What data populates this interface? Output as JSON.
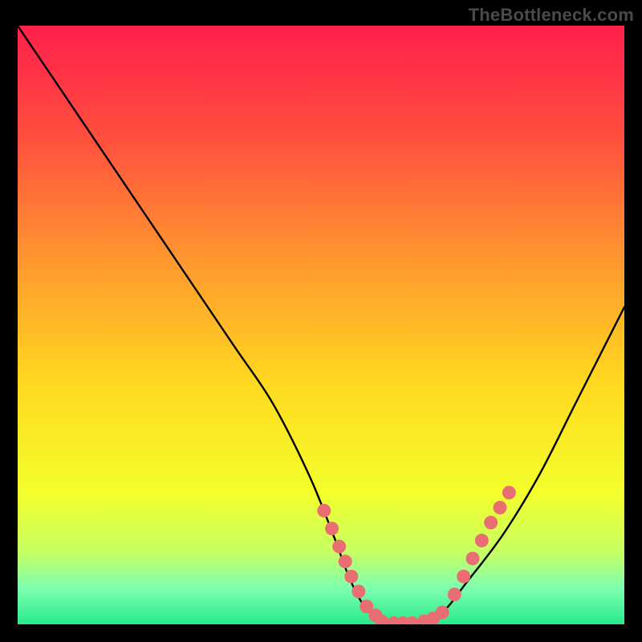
{
  "watermark": "TheBottleneck.com",
  "chart_data": {
    "type": "line",
    "title": "",
    "xlabel": "",
    "ylabel": "",
    "xlim": [
      0,
      100
    ],
    "ylim": [
      0,
      100
    ],
    "grid": false,
    "legend": false,
    "series": [
      {
        "name": "bottleneck-curve",
        "x": [
          0,
          6,
          12,
          18,
          24,
          30,
          36,
          42,
          48,
          52,
          55,
          58,
          62,
          66,
          70,
          74,
          80,
          86,
          92,
          100
        ],
        "y": [
          100,
          91,
          82,
          73,
          64,
          55,
          46,
          37,
          25,
          15,
          7,
          2,
          0,
          0,
          2,
          7,
          15,
          25,
          37,
          53
        ]
      }
    ],
    "markers": [
      {
        "name": "left-dots",
        "x": [
          50.5,
          51.8,
          53.0,
          54.0,
          55.0,
          56.2,
          57.5,
          59.0
        ],
        "y": [
          19.0,
          16.0,
          13.0,
          10.5,
          8.0,
          5.5,
          3.0,
          1.5
        ]
      },
      {
        "name": "bottom-dots",
        "x": [
          60.0,
          62.0,
          63.5,
          65.0,
          67.0,
          68.5,
          70.0
        ],
        "y": [
          0.5,
          0.2,
          0.2,
          0.2,
          0.5,
          1.0,
          2.0
        ]
      },
      {
        "name": "right-dots",
        "x": [
          72.0,
          73.5,
          75.0,
          76.5,
          78.0,
          79.5,
          81.0
        ],
        "y": [
          5.0,
          8.0,
          11.0,
          14.0,
          17.0,
          19.5,
          22.0
        ]
      }
    ],
    "gradient_stops": [
      {
        "offset": 0.0,
        "color": "#ff1f4b"
      },
      {
        "offset": 0.18,
        "color": "#ff4d3f"
      },
      {
        "offset": 0.4,
        "color": "#ff9a2e"
      },
      {
        "offset": 0.6,
        "color": "#ffd91f"
      },
      {
        "offset": 0.78,
        "color": "#f3ff2b"
      },
      {
        "offset": 0.88,
        "color": "#c6ff63"
      },
      {
        "offset": 0.94,
        "color": "#7dffb0"
      },
      {
        "offset": 1.0,
        "color": "#28e98c"
      }
    ],
    "marker_color": "#e96e72",
    "curve_color": "#000000"
  }
}
